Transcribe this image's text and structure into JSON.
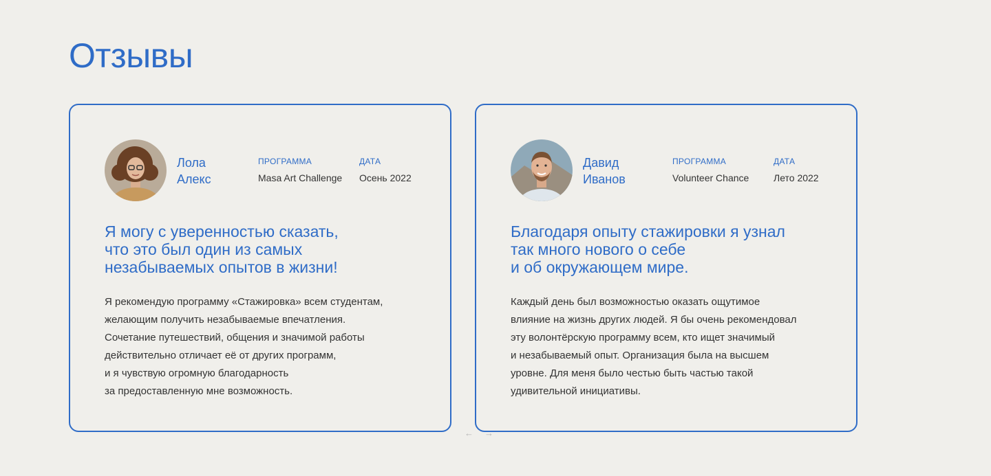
{
  "section": {
    "title": "Отзывы"
  },
  "labels": {
    "program": "ПРОГРАММА",
    "date": "ДАТА"
  },
  "reviews": [
    {
      "name": "Лола\nАлекс",
      "program": "Masa Art Challenge",
      "date": "Осень 2022",
      "quote": "Я могу с уверенностью сказать,\nчто это был один из самых\nнезабываемых опытов в жизни!",
      "text": "Я рекомендую программу «Стажировка» всем студентам,\nжелающим получить незабываемые впечатления.\nСочетание путешествий, общения и значимой работы\nдействительно отличает её от других программ,\nи я чувствую огромную благодарность\nза предоставленную мне возможность."
    },
    {
      "name": "Давид\nИванов",
      "program": "Volunteer Chance",
      "date": "Лето 2022",
      "quote": "Благодаря опыту стажировки я узнал\nтак много нового о себе\nи об окружающем мире.",
      "text": "Каждый день был возможностью оказать ощутимое\nвлияние на жизнь других людей. Я бы очень рекомендовал\nэту волонтёрскую программу всем, кто ищет значимый\nи незабываемый опыт. Организация была на высшем\nуровне. Для меня было честью быть частью такой\nудивительной инициативы."
    }
  ],
  "nav": {
    "prev": "←",
    "next": "→"
  },
  "colors": {
    "accent": "#2f6cc7",
    "background": "#f0efeb",
    "text": "#333333"
  },
  "icons": {
    "prev": "arrow-left-icon",
    "next": "arrow-right-icon"
  }
}
